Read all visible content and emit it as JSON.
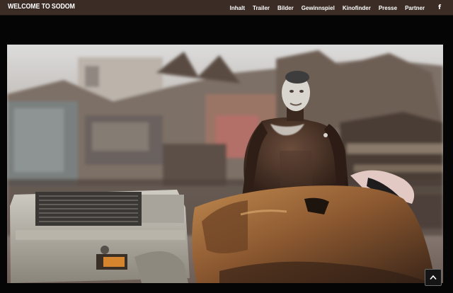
{
  "header": {
    "brand": "WELCOME TO SODOM",
    "nav": [
      "Inhalt",
      "Trailer",
      "Bilder",
      "Gewinnspiel",
      "Kinofinder",
      "Presse",
      "Partner"
    ],
    "facebook_icon": "facebook-icon"
  },
  "hero": {
    "image": "still-man-scrapyard"
  },
  "scroll_top": {
    "icon": "chevron-up-icon"
  },
  "colors": {
    "topbar": "#3b2c25",
    "background": "#050505",
    "text": "#ffffff"
  }
}
